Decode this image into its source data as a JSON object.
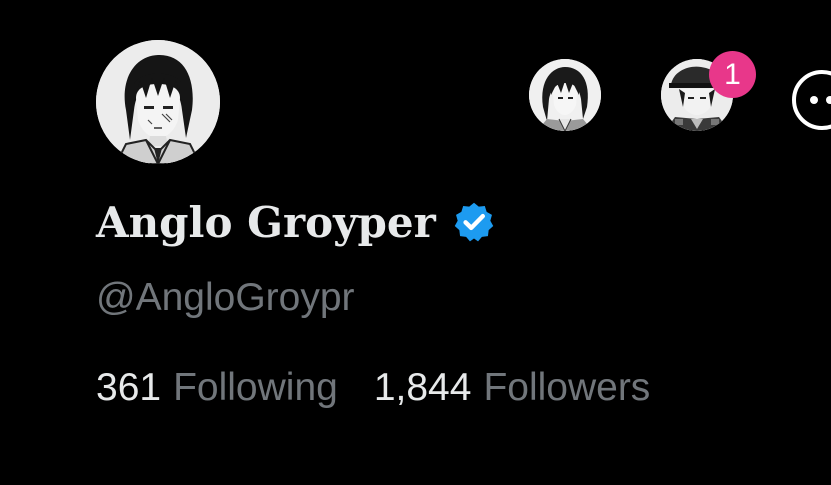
{
  "profile": {
    "display_name": "Anglo Groyper",
    "handle": "@AngloGroypr",
    "verified": true,
    "verified_icon": "verified-badge-icon",
    "verified_color": "#1d9bf0"
  },
  "stats": {
    "following_count": "361",
    "following_label": "Following",
    "followers_count": "1,844",
    "followers_label": "Followers"
  },
  "account_switcher": {
    "notification_count": "1",
    "badge_color": "#e8378a"
  },
  "colors": {
    "background": "#000000",
    "primary_text": "#e7e9ea",
    "secondary_text": "#71767b"
  }
}
